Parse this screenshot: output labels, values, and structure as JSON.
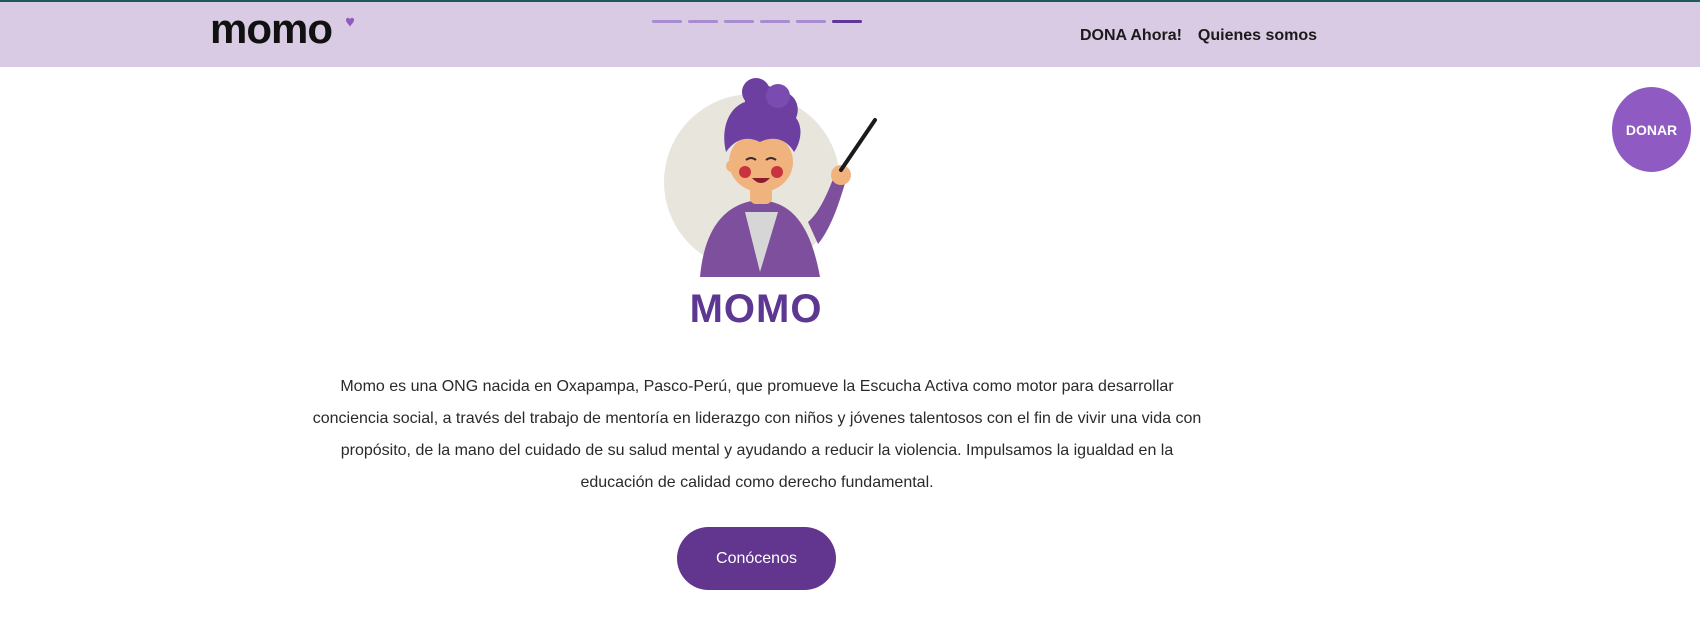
{
  "brand": {
    "logo_text": "momo",
    "logo_color": "#111111",
    "accent_heart": "#8f5ac2"
  },
  "header": {
    "background": "#d8cbe3",
    "progress": {
      "segments": 6,
      "active_index": 5
    },
    "nav": [
      {
        "label": "DONA Ahora!"
      },
      {
        "label": "Quienes somos"
      }
    ]
  },
  "floating_donate": {
    "label": "DONAR",
    "color": "#8f5ac2"
  },
  "hero": {
    "illustration_icon": "teacher-with-pointer-illustration",
    "title": "MOMO",
    "title_color": "#5d3791",
    "description": "Momo es una ONG nacida en Oxapampa, Pasco-Perú, que promueve la Escucha Activa como motor para desarrollar conciencia social, a través del trabajo de mentoría en liderazgo con niños y jóvenes talentosos con el fin de vivir una vida con propósito, de la mano del cuidado de su salud mental y ayudando a reducir la violencia. Impulsamos la igualdad en la educación de calidad como derecho fundamental.",
    "cta_label": "Conócenos",
    "cta_color": "#62358f"
  }
}
